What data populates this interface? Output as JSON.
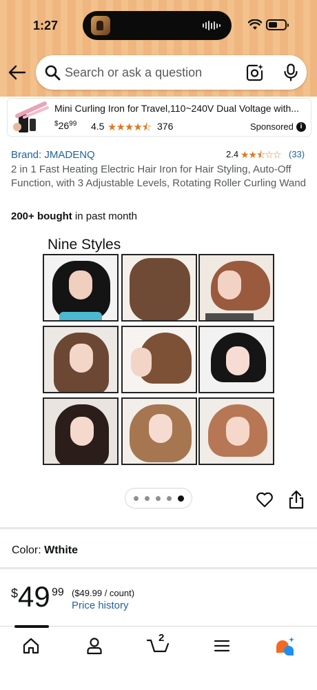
{
  "status_bar": {
    "time": "1:27"
  },
  "search": {
    "placeholder": "Search or ask a question"
  },
  "sponsored_ad": {
    "title": "Mini Curling Iron for Travel,110~240V Dual Voltage with...",
    "price_symbol": "$",
    "price_whole": "26",
    "price_fraction": "99",
    "rating": "4.5",
    "stars": "★★★★⯪",
    "review_count": "376",
    "sponsored_label": "Sponsored",
    "info_glyph": "i"
  },
  "product": {
    "brand": "Brand: JMADENQ",
    "rating": "2.4",
    "stars": "★★⯪☆☆",
    "review_count": "(33)",
    "title": "2 in 1 Fast Heating Electric Hair Iron for Hair Styling, Auto-Off Function, with 3 Adjustable Levels, Rotating Roller Curling Wand",
    "bought_bold": "200+ bought",
    "bought_rest": " in past month",
    "image_caption": "Nine Styles",
    "carousel": {
      "count": 5,
      "active_index": 4
    }
  },
  "color": {
    "label": "Color: ",
    "value": "Wthite"
  },
  "price": {
    "symbol": "$",
    "whole": "49",
    "fraction": "99",
    "per_unit": "($49.99 / count)",
    "history_link": "Price history"
  },
  "bottom_nav": {
    "cart_count": "2",
    "items": [
      "home-icon",
      "account-icon",
      "cart-icon",
      "menu-icon",
      "rufus-icon"
    ]
  },
  "colors": {
    "header_bg": "#f2c18c",
    "link": "#2162a1",
    "star": "#de7921",
    "text": "#0f1111"
  }
}
